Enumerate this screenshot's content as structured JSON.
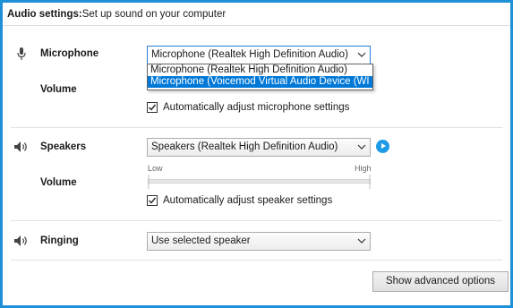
{
  "title": {
    "bold": "Audio settings:",
    "rest": " Set up sound on your computer"
  },
  "microphone": {
    "label": "Microphone",
    "icon": "microphone-icon",
    "selected": "Microphone (Realtek High Definition Audio)",
    "options": [
      "Microphone (Realtek High Definition Audio)",
      "Microphone (Voicemod Virtual Audio Device (WI"
    ],
    "volume_label": "Volume",
    "auto_adjust": "Automatically adjust microphone settings",
    "auto_adjust_checked": true
  },
  "speakers": {
    "label": "Speakers",
    "icon": "speaker-icon",
    "selected": "Speakers (Realtek High Definition Audio)",
    "low_label": "Low",
    "high_label": "High",
    "volume_label": "Volume",
    "auto_adjust": "Automatically adjust speaker settings",
    "auto_adjust_checked": true
  },
  "ringing": {
    "label": "Ringing",
    "icon": "speaker-icon",
    "selected": "Use selected speaker"
  },
  "advanced_button": "Show advanced options",
  "colors": {
    "accent": "#1e90d8",
    "selection": "#0078d7",
    "play": "#1e9be6"
  }
}
